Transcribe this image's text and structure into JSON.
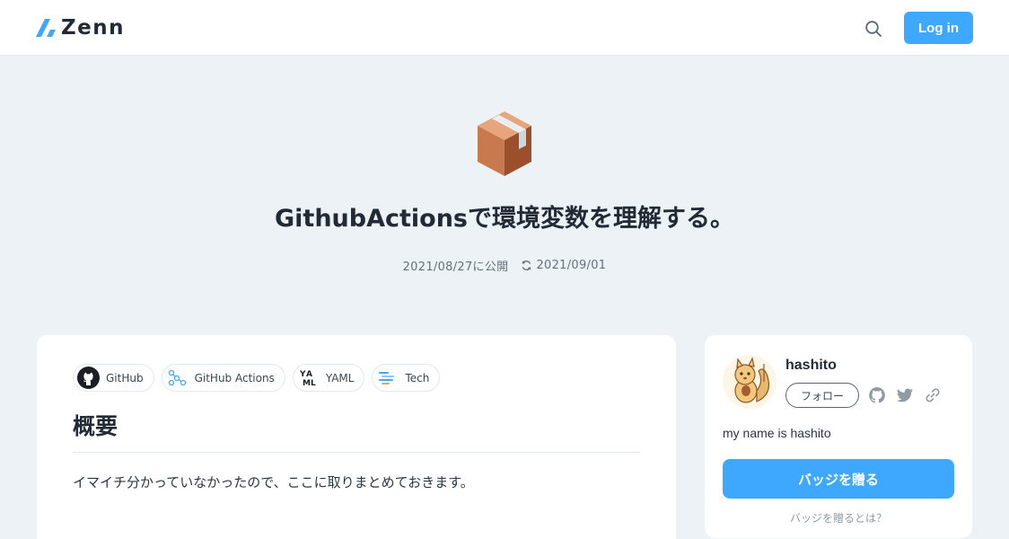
{
  "header": {
    "logo_text": "Zenn",
    "search_icon": "search-icon",
    "login_label": "Log in"
  },
  "article": {
    "emoji_icon": "package-box-icon",
    "title": "GithubActionsで環境変数を理解する。",
    "published": "2021/08/27に公開",
    "updated": "2021/09/01",
    "topics": [
      {
        "label": "GitHub",
        "icon": "github-icon"
      },
      {
        "label": "GitHub Actions",
        "icon": "github-actions-icon"
      },
      {
        "label": "YAML",
        "icon": "yaml-icon"
      },
      {
        "label": "Tech",
        "icon": "tech-icon"
      }
    ],
    "heading": "概要",
    "paragraph": "イマイチ分かっていなかったので、ここに取りまとめておきます。"
  },
  "author": {
    "name": "hashito",
    "follow_label": "フォロー",
    "bio": "my name is hashito",
    "badge_label": "バッジを贈る",
    "badge_help": "バッジを贈るとは？"
  },
  "colors": {
    "accent": "#3ea8ff",
    "background": "#edf2f7"
  }
}
